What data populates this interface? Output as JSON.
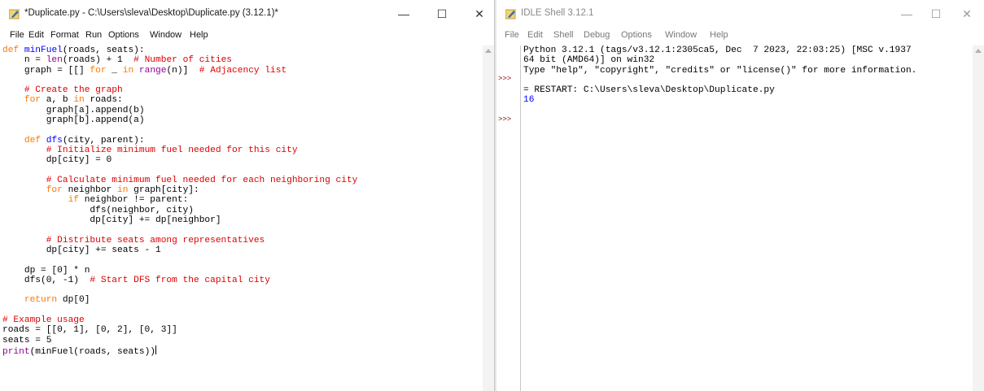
{
  "editor": {
    "title": "*Duplicate.py - C:\\Users\\sleva\\Desktop\\Duplicate.py (3.12.1)*",
    "menu": [
      "File",
      "Edit",
      "Format",
      "Run",
      "Options",
      "Window",
      "Help"
    ],
    "controls": {
      "minimize": "—",
      "maximize": "☐",
      "close": "✕"
    },
    "code_lines": [
      [
        {
          "t": "def",
          "c": "kw"
        },
        {
          "t": " "
        },
        {
          "t": "minFuel",
          "c": "def"
        },
        {
          "t": "(roads, seats):"
        }
      ],
      [
        {
          "t": "    n = "
        },
        {
          "t": "len",
          "c": "bi"
        },
        {
          "t": "(roads) + 1  "
        },
        {
          "t": "# Number of cities",
          "c": "cm"
        }
      ],
      [
        {
          "t": "    graph = [[] "
        },
        {
          "t": "for",
          "c": "kw"
        },
        {
          "t": " _ "
        },
        {
          "t": "in",
          "c": "kw"
        },
        {
          "t": " "
        },
        {
          "t": "range",
          "c": "bi"
        },
        {
          "t": "(n)]  "
        },
        {
          "t": "# Adjacency list",
          "c": "cm"
        }
      ],
      [
        {
          "t": ""
        }
      ],
      [
        {
          "t": "    "
        },
        {
          "t": "# Create the graph",
          "c": "cm"
        }
      ],
      [
        {
          "t": "    "
        },
        {
          "t": "for",
          "c": "kw"
        },
        {
          "t": " a, b "
        },
        {
          "t": "in",
          "c": "kw"
        },
        {
          "t": " roads:"
        }
      ],
      [
        {
          "t": "        graph[a].append(b)"
        }
      ],
      [
        {
          "t": "        graph[b].append(a)"
        }
      ],
      [
        {
          "t": ""
        }
      ],
      [
        {
          "t": "    "
        },
        {
          "t": "def",
          "c": "kw"
        },
        {
          "t": " "
        },
        {
          "t": "dfs",
          "c": "def"
        },
        {
          "t": "(city, parent):"
        }
      ],
      [
        {
          "t": "        "
        },
        {
          "t": "# Initialize minimum fuel needed for this city",
          "c": "cm"
        }
      ],
      [
        {
          "t": "        dp[city] = 0"
        }
      ],
      [
        {
          "t": ""
        }
      ],
      [
        {
          "t": "        "
        },
        {
          "t": "# Calculate minimum fuel needed for each neighboring city",
          "c": "cm"
        }
      ],
      [
        {
          "t": "        "
        },
        {
          "t": "for",
          "c": "kw"
        },
        {
          "t": " neighbor "
        },
        {
          "t": "in",
          "c": "kw"
        },
        {
          "t": " graph[city]:"
        }
      ],
      [
        {
          "t": "            "
        },
        {
          "t": "if",
          "c": "kw"
        },
        {
          "t": " neighbor != parent:"
        }
      ],
      [
        {
          "t": "                dfs(neighbor, city)"
        }
      ],
      [
        {
          "t": "                dp[city] += dp[neighbor]"
        }
      ],
      [
        {
          "t": ""
        }
      ],
      [
        {
          "t": "        "
        },
        {
          "t": "# Distribute seats among representatives",
          "c": "cm"
        }
      ],
      [
        {
          "t": "        dp[city] += seats - 1"
        }
      ],
      [
        {
          "t": ""
        }
      ],
      [
        {
          "t": "    dp = [0] * n"
        }
      ],
      [
        {
          "t": "    dfs(0, -1)  "
        },
        {
          "t": "# Start DFS from the capital city",
          "c": "cm"
        }
      ],
      [
        {
          "t": ""
        }
      ],
      [
        {
          "t": "    "
        },
        {
          "t": "return",
          "c": "kw"
        },
        {
          "t": " dp[0]"
        }
      ],
      [
        {
          "t": ""
        }
      ],
      [
        {
          "t": "# Example usage",
          "c": "cm"
        }
      ],
      [
        {
          "t": "roads = [[0, 1], [0, 2], [0, 3]]"
        }
      ],
      [
        {
          "t": "seats = 5"
        }
      ],
      [
        {
          "t": "print",
          "c": "bi"
        },
        {
          "t": "(minFuel(roads, seats))"
        },
        {
          "t": "",
          "cursor": true
        }
      ]
    ]
  },
  "shell": {
    "title": "IDLE Shell 3.12.1",
    "menu": [
      "File",
      "Edit",
      "Shell",
      "Debug",
      "Options",
      "Window",
      "Help"
    ],
    "controls": {
      "minimize": "—",
      "maximize": "☐",
      "close": "✕"
    },
    "prompt": ">>>",
    "code_lines": [
      [
        {
          "t": "Python 3.12.1 (tags/v3.12.1:2305ca5, Dec  7 2023, 22:03:25) [MSC v.1937"
        }
      ],
      [
        {
          "t": "64 bit (AMD64)] on win32"
        }
      ],
      [
        {
          "t": "Type \"help\", \"copyright\", \"credits\" or \"license()\" for more information."
        }
      ],
      [
        {
          "t": ""
        }
      ],
      [
        {
          "t": "= RESTART: C:\\Users\\sleva\\Desktop\\Duplicate.py"
        }
      ],
      [
        {
          "t": "16",
          "c": "out"
        }
      ]
    ],
    "prompt_lines": [
      3,
      7
    ]
  }
}
